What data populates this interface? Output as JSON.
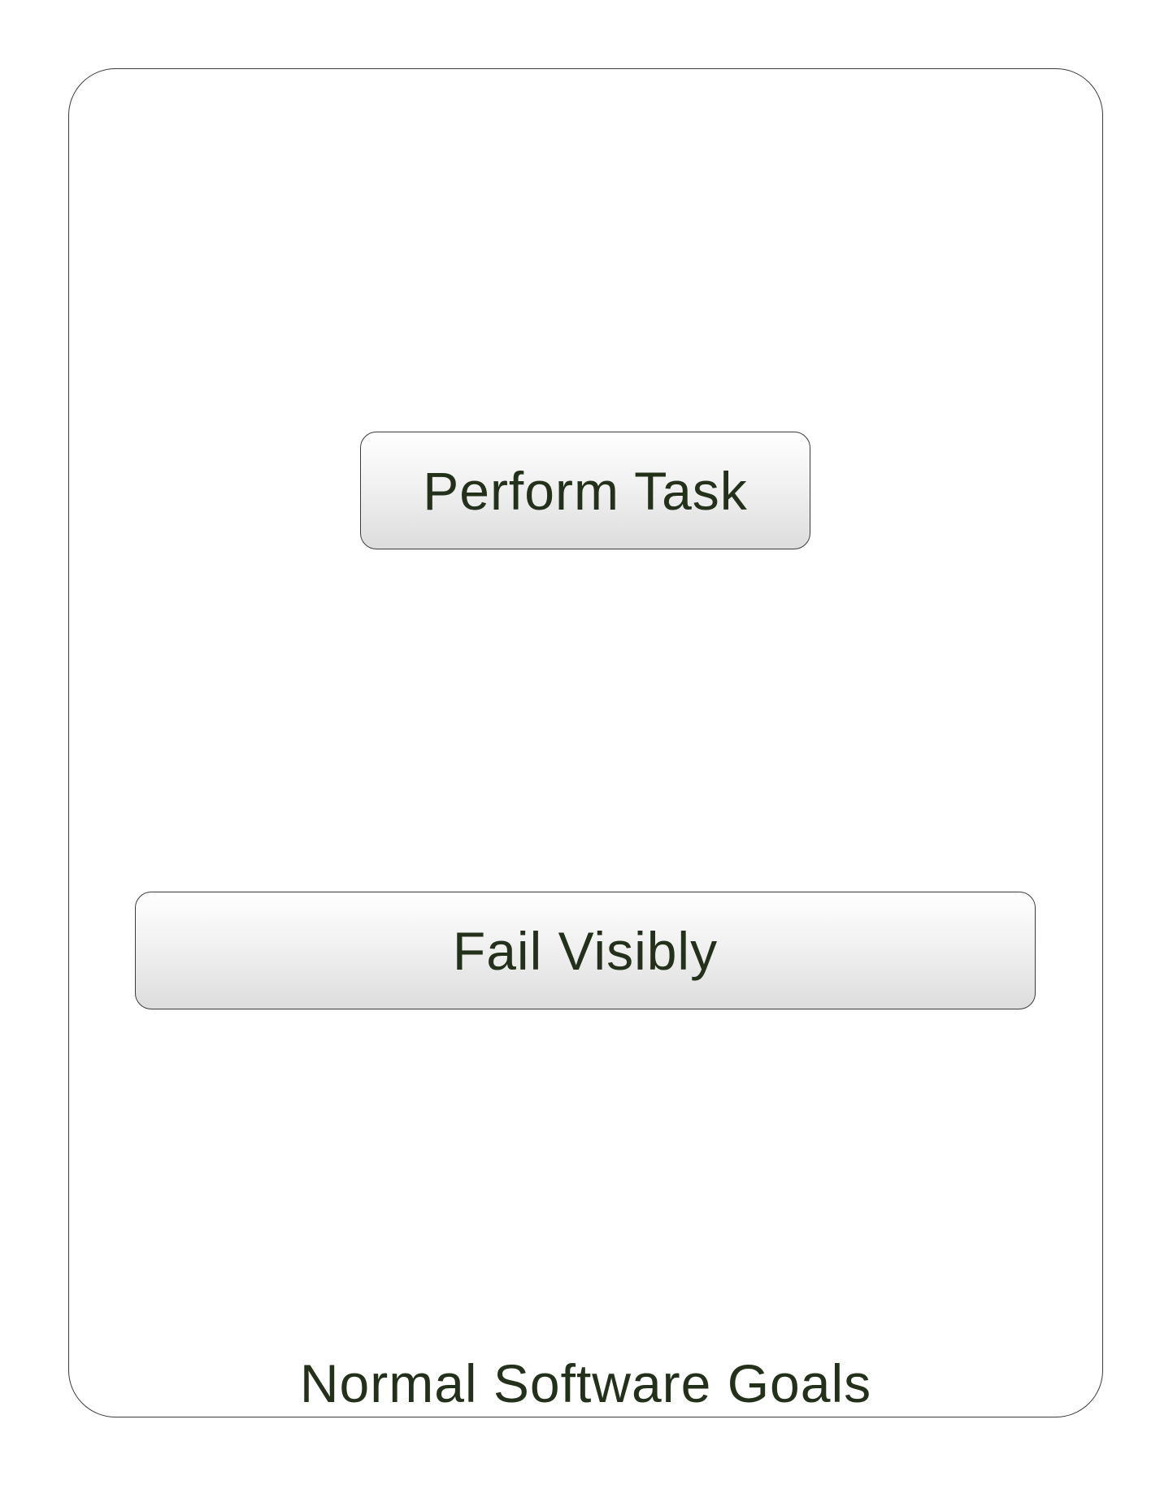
{
  "diagram": {
    "caption": "Normal Software Goals",
    "buttons": {
      "perform_task": "Perform Task",
      "fail_visibly": "Fail Visibly"
    },
    "colors": {
      "text": "#24311a",
      "border": "#3a3a3a",
      "gradient_top": "#ffffff",
      "gradient_bottom": "#dddddd"
    }
  }
}
